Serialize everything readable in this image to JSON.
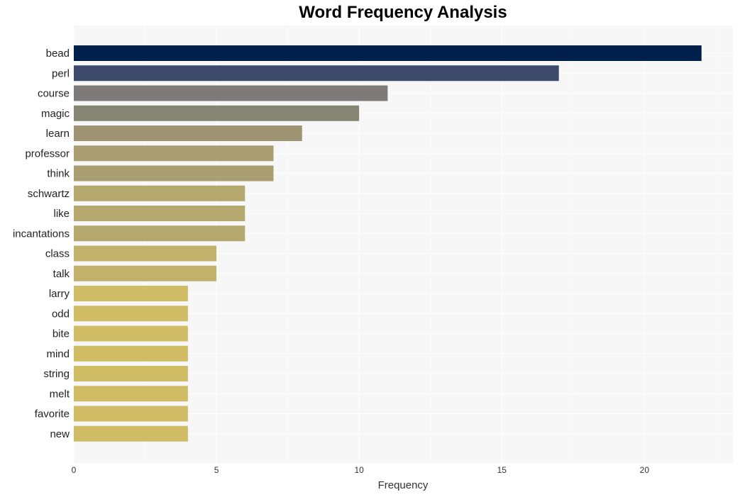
{
  "chart_data": {
    "type": "bar",
    "orientation": "horizontal",
    "title": "Word Frequency Analysis",
    "xlabel": "Frequency",
    "ylabel": "",
    "xlim": [
      0,
      23.1
    ],
    "xticks": [
      0,
      5,
      10,
      15,
      20
    ],
    "grid": true,
    "legend": "none",
    "categories": [
      "bead",
      "perl",
      "course",
      "magic",
      "learn",
      "professor",
      "think",
      "schwartz",
      "like",
      "incantations",
      "class",
      "talk",
      "larry",
      "odd",
      "bite",
      "mind",
      "string",
      "melt",
      "favorite",
      "new"
    ],
    "values": [
      22,
      17,
      11,
      10,
      8,
      7,
      7,
      6,
      6,
      6,
      5,
      5,
      4,
      4,
      4,
      4,
      4,
      4,
      4,
      4
    ],
    "colors": [
      "#00204c",
      "#3d4a6b",
      "#7c7b78",
      "#868574",
      "#9e9474",
      "#aa9e72",
      "#aa9e72",
      "#b4a86f",
      "#b4a86f",
      "#b4a86f",
      "#c1b16a",
      "#c1b16a",
      "#cfbc64",
      "#cfbc64",
      "#cfbc64",
      "#cfbc64",
      "#cfbc64",
      "#cfbc64",
      "#cfbc64",
      "#cfbc64"
    ],
    "plot_background": "#f7f7f7"
  }
}
